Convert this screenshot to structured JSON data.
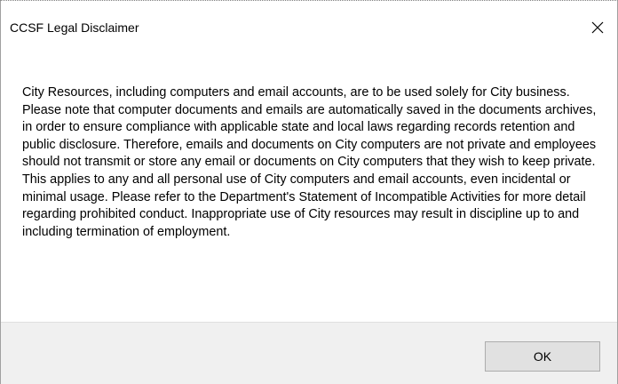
{
  "dialog": {
    "title": "CCSF Legal Disclaimer",
    "close_icon": "close-icon",
    "message": "City Resources, including computers and email accounts, are to be used solely for City business.  Please note that computer documents and emails are automatically saved in the documents archives, in order to ensure compliance with applicable state and local laws regarding records retention and public disclosure. Therefore, emails and documents on City computers are not private and employees should not transmit or store any email or documents on City computers that they wish to keep private. This applies to any and all personal use of City computers and email accounts, even incidental or minimal usage. Please refer to the Department's Statement of Incompatible Activities for more detail regarding prohibited conduct.  Inappropriate use of City resources may result in discipline up to and including termination of employment.",
    "ok_label": "OK"
  },
  "colors": {
    "footer_background": "#f0f0f0",
    "button_background": "#e1e1e1",
    "button_border": "#adadad",
    "text": "#000000"
  }
}
